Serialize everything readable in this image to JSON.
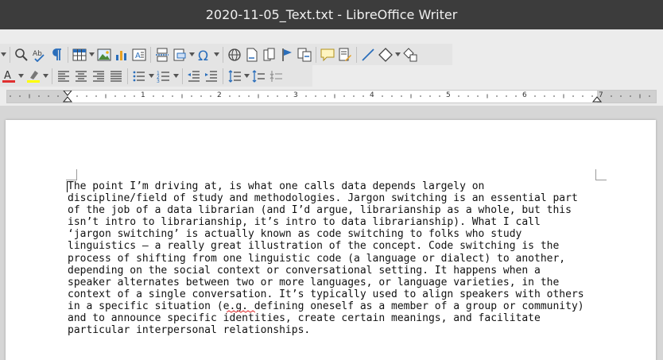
{
  "window": {
    "title": "2020-11-05_Text.txt - LibreOffice Writer"
  },
  "toolbar1": [
    "find-replace-icon",
    "spelling-icon",
    "formatting-marks-icon",
    "insert-table-icon",
    "insert-image-icon",
    "insert-chart-icon",
    "insert-textbox-icon",
    "page-break-icon",
    "insert-field-icon",
    "special-character-icon",
    "hyperlink-icon",
    "footnote-icon",
    "endnote-icon",
    "bookmark-icon",
    "cross-reference-icon",
    "comment-icon",
    "track-changes-icon",
    "line-icon",
    "basic-shapes-icon",
    "draw-functions-icon"
  ],
  "toolbar2": [
    "font-color-icon",
    "highlight-icon",
    "align-left-icon",
    "align-center-icon",
    "align-right-icon",
    "justify-icon",
    "bullets-icon",
    "numbering-icon",
    "indent-decrease-icon",
    "indent-increase-icon",
    "line-spacing-icon",
    "paragraph-spacing-increase-icon",
    "paragraph-spacing-decrease-icon"
  ],
  "colors": {
    "font_color": "#e03030",
    "highlight_color": "#ffff00",
    "accent": "#2a6ebb"
  },
  "ruler": {
    "labels": [
      "1",
      "2",
      "3",
      "4",
      "5",
      "6",
      "7"
    ]
  },
  "document": {
    "lines": [
      "The point I’m driving at, is what one calls data depends largely on",
      "discipline/field of study and methodologies. Jargon switching is an essential part",
      "of the job of a data librarian (and I’d argue, librarianship as a whole, but this",
      "isn’t intro to librarianship, it’s intro to data librarianship). What I call",
      "‘jargon switching’ is actually known as code switching to folks who study",
      "linguistics – a really great illustration of the concept. Code switching is the",
      "process of shifting from one linguistic code (a language or dialect) to another,",
      "depending on the social context or conversational setting. It happens when a",
      "speaker alternates between two or more languages, or language varieties, in the",
      "context of a single conversation. It’s typically used to align speakers with others",
      "in a specific situation (e.g. defining oneself as a member of a group or community)",
      "and to announce specific identities, create certain meanings, and facilitate",
      "particular interpersonal relationships."
    ]
  }
}
